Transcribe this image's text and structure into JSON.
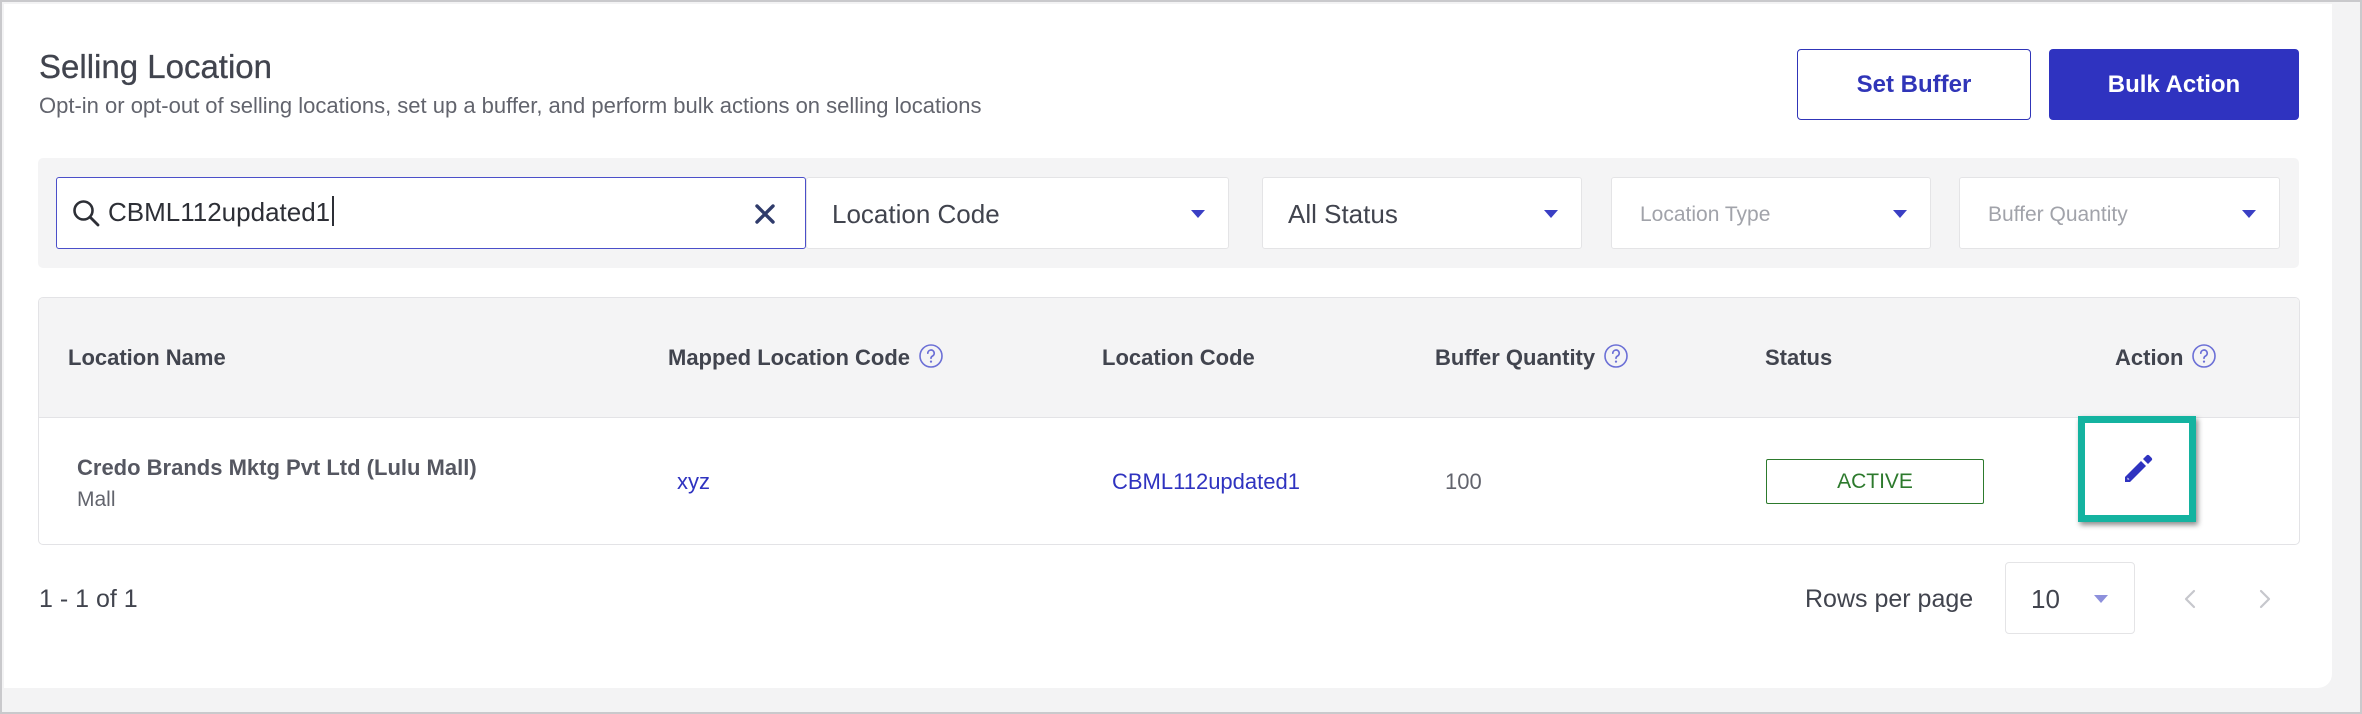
{
  "header": {
    "title": "Selling Location",
    "subtitle": "Opt-in or opt-out of selling locations, set up a buffer, and perform bulk actions on selling locations",
    "set_buffer_label": "Set Buffer",
    "bulk_action_label": "Bulk Action"
  },
  "filters": {
    "search_value": "CBML112updated1",
    "location_code_select": "Location Code",
    "status_select": "All Status",
    "location_type_placeholder": "Location Type",
    "buffer_quantity_placeholder": "Buffer Quantity"
  },
  "table": {
    "columns": {
      "location_name": "Location Name",
      "mapped_location_code": "Mapped Location Code",
      "location_code": "Location Code",
      "buffer_quantity": "Buffer Quantity",
      "status": "Status",
      "action": "Action"
    },
    "rows": [
      {
        "location_name": "Credo Brands Mktg Pvt Ltd (Lulu Mall)",
        "location_subtype": "Mall",
        "mapped_location_code": "xyz",
        "location_code": "CBML112updated1",
        "buffer_quantity": "100",
        "status": "ACTIVE"
      }
    ]
  },
  "pagination": {
    "count_text": "1 - 1 of 1",
    "rows_per_page_label": "Rows per page",
    "rows_per_page_value": "10"
  },
  "colors": {
    "primary": "#2f33c0",
    "active_green": "#2d7a2d",
    "highlight_teal": "#14b3a0"
  },
  "icons": {
    "search": "search-icon",
    "clear": "close-icon",
    "dropdown": "chevron-down-icon",
    "help": "help-circle-icon",
    "edit": "pencil-icon",
    "prev": "chevron-left-icon",
    "next": "chevron-right-icon"
  }
}
